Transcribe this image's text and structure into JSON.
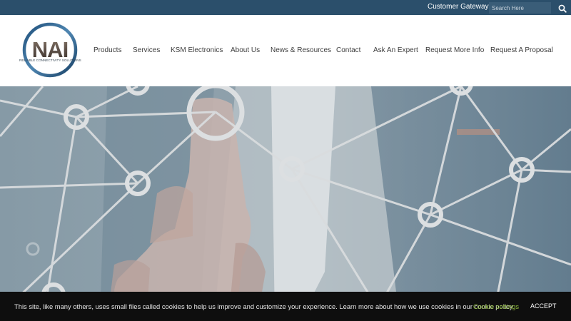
{
  "topbar": {
    "gateway_label": "Customer Gateway",
    "search_placeholder": "Search Here",
    "search_icon": "search-icon"
  },
  "logo": {
    "text": "NAI",
    "tagline": "RELIABLE CONNECTIVITY SOLUTIONS"
  },
  "nav": {
    "items": [
      {
        "label": "Products"
      },
      {
        "label": "Services"
      },
      {
        "label": "KSM Electronics"
      },
      {
        "label": "About Us"
      },
      {
        "label": "News & Resources"
      },
      {
        "label": "Contact"
      },
      {
        "label": "Ask An Expert"
      },
      {
        "label": "Request More Info"
      },
      {
        "label": "Request A Proposal"
      }
    ]
  },
  "cookie": {
    "message": "This site, like many others, uses small files called cookies to help us improve and customize your experience. Learn more about how we use cookies in our cookie policy.",
    "settings_label": "Cookie settings",
    "accept_label": "ACCEPT"
  },
  "colors": {
    "topbar": "#2b4f6b",
    "cookie_bar": "#0e0e0e",
    "cookie_link": "#8cb83a",
    "nav_text": "#3d3d3d"
  }
}
